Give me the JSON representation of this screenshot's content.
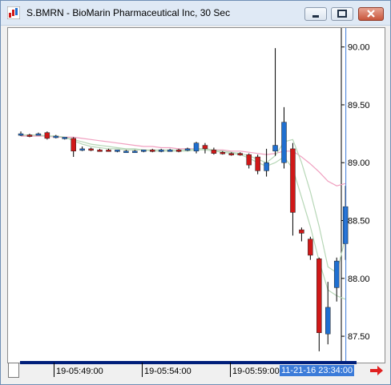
{
  "window": {
    "title": "S.BMRN - BioMarin Pharmaceutical Inc, 30 Sec",
    "buttons": {
      "minimize": "minimize",
      "maximize": "maximize",
      "close": "close"
    }
  },
  "colors": {
    "up_candle": "#1f6fd0",
    "down_candle": "#d01818",
    "ma_fast": "#b7d7b7",
    "ma_slow": "#f0a0c0",
    "cursor_line": "#3b7bd9",
    "scroll_track": "#001f7a"
  },
  "time_axis": {
    "labels": [
      "19-05:49:00",
      "19-05:54:00",
      "19-05:59:00"
    ],
    "cursor_time": "11-21-16 23:34:00"
  },
  "chart_data": {
    "type": "candlestick",
    "title": "S.BMRN - BioMarin Pharmaceutical Inc, 30 Sec",
    "ylim": [
      87.3,
      90.15
    ],
    "yticks": [
      "90.00",
      "89.50",
      "89.00",
      "88.50",
      "88.00",
      "87.50"
    ],
    "candles": [
      {
        "o": 89.25,
        "h": 89.27,
        "l": 89.23,
        "c": 89.25
      },
      {
        "o": 89.24,
        "h": 89.25,
        "l": 89.22,
        "c": 89.23
      },
      {
        "o": 89.25,
        "h": 89.26,
        "l": 89.24,
        "c": 89.25
      },
      {
        "o": 89.26,
        "h": 89.27,
        "l": 89.2,
        "c": 89.21
      },
      {
        "o": 89.22,
        "h": 89.24,
        "l": 89.21,
        "c": 89.23
      },
      {
        "o": 89.21,
        "h": 89.22,
        "l": 89.2,
        "c": 89.22
      },
      {
        "o": 89.21,
        "h": 89.22,
        "l": 89.05,
        "c": 89.1
      },
      {
        "o": 89.12,
        "h": 89.14,
        "l": 89.1,
        "c": 89.12
      },
      {
        "o": 89.12,
        "h": 89.13,
        "l": 89.1,
        "c": 89.11
      },
      {
        "o": 89.11,
        "h": 89.12,
        "l": 89.1,
        "c": 89.1
      },
      {
        "o": 89.11,
        "h": 89.12,
        "l": 89.1,
        "c": 89.1
      },
      {
        "o": 89.1,
        "h": 89.11,
        "l": 89.09,
        "c": 89.11
      },
      {
        "o": 89.1,
        "h": 89.11,
        "l": 89.09,
        "c": 89.1
      },
      {
        "o": 89.1,
        "h": 89.11,
        "l": 89.09,
        "c": 89.1
      },
      {
        "o": 89.1,
        "h": 89.11,
        "l": 89.09,
        "c": 89.11
      },
      {
        "o": 89.11,
        "h": 89.12,
        "l": 89.09,
        "c": 89.1
      },
      {
        "o": 89.1,
        "h": 89.12,
        "l": 89.09,
        "c": 89.11
      },
      {
        "o": 89.11,
        "h": 89.12,
        "l": 89.1,
        "c": 89.11
      },
      {
        "o": 89.11,
        "h": 89.12,
        "l": 89.09,
        "c": 89.1
      },
      {
        "o": 89.11,
        "h": 89.13,
        "l": 89.1,
        "c": 89.12
      },
      {
        "o": 89.1,
        "h": 89.18,
        "l": 89.08,
        "c": 89.17
      },
      {
        "o": 89.15,
        "h": 89.17,
        "l": 89.08,
        "c": 89.12
      },
      {
        "o": 89.11,
        "h": 89.13,
        "l": 89.07,
        "c": 89.08
      },
      {
        "o": 89.09,
        "h": 89.1,
        "l": 89.07,
        "c": 89.08
      },
      {
        "o": 89.08,
        "h": 89.09,
        "l": 89.06,
        "c": 89.07
      },
      {
        "o": 89.08,
        "h": 89.09,
        "l": 89.06,
        "c": 89.07
      },
      {
        "o": 89.07,
        "h": 89.08,
        "l": 88.95,
        "c": 88.98
      },
      {
        "o": 89.05,
        "h": 89.07,
        "l": 88.9,
        "c": 88.93
      },
      {
        "o": 88.93,
        "h": 89.12,
        "l": 88.88,
        "c": 89.0
      },
      {
        "o": 89.1,
        "h": 89.99,
        "l": 89.06,
        "c": 89.15
      },
      {
        "o": 89.0,
        "h": 89.48,
        "l": 88.95,
        "c": 89.35
      },
      {
        "o": 89.12,
        "h": 89.17,
        "l": 88.37,
        "c": 88.57
      },
      {
        "o": 88.42,
        "h": 88.44,
        "l": 88.32,
        "c": 88.39
      },
      {
        "o": 88.34,
        "h": 88.36,
        "l": 88.16,
        "c": 88.2
      },
      {
        "o": 88.17,
        "h": 88.18,
        "l": 87.37,
        "c": 87.53
      },
      {
        "o": 87.52,
        "h": 87.97,
        "l": 87.43,
        "c": 87.75
      },
      {
        "o": 87.92,
        "h": 88.18,
        "l": 87.8,
        "c": 88.15
      },
      {
        "o": 88.3,
        "h": 88.8,
        "l": 88.16,
        "c": 88.62
      }
    ],
    "ma_fast": [
      89.24,
      89.24,
      89.24,
      89.23,
      89.23,
      89.22,
      89.2,
      89.18,
      89.16,
      89.15,
      89.14,
      89.13,
      89.12,
      89.12,
      89.11,
      89.11,
      89.11,
      89.11,
      89.11,
      89.11,
      89.12,
      89.12,
      89.11,
      89.1,
      89.09,
      89.08,
      89.06,
      89.03,
      89.0,
      89.06,
      89.18,
      89.2,
      89.0,
      88.75,
      88.45,
      88.1,
      88.05,
      88.35
    ],
    "ma_slow": [
      89.23,
      89.23,
      89.23,
      89.23,
      89.22,
      89.22,
      89.22,
      89.21,
      89.2,
      89.19,
      89.18,
      89.17,
      89.16,
      89.15,
      89.14,
      89.14,
      89.13,
      89.13,
      89.12,
      89.12,
      89.12,
      89.12,
      89.11,
      89.11,
      89.1,
      89.1,
      89.09,
      89.08,
      89.07,
      89.08,
      89.1,
      89.1,
      89.05,
      88.99,
      88.92,
      88.84,
      88.8,
      88.82
    ],
    "ma_lower": [
      89.24,
      89.24,
      89.24,
      89.23,
      89.23,
      89.22,
      89.19,
      89.16,
      89.14,
      89.13,
      89.12,
      89.12,
      89.11,
      89.11,
      89.11,
      89.1,
      89.1,
      89.1,
      89.1,
      89.1,
      89.11,
      89.11,
      89.1,
      89.09,
      89.08,
      89.07,
      89.04,
      89.0,
      88.97,
      89.0,
      89.05,
      88.95,
      88.7,
      88.45,
      88.15,
      87.9,
      87.85,
      87.82
    ]
  }
}
